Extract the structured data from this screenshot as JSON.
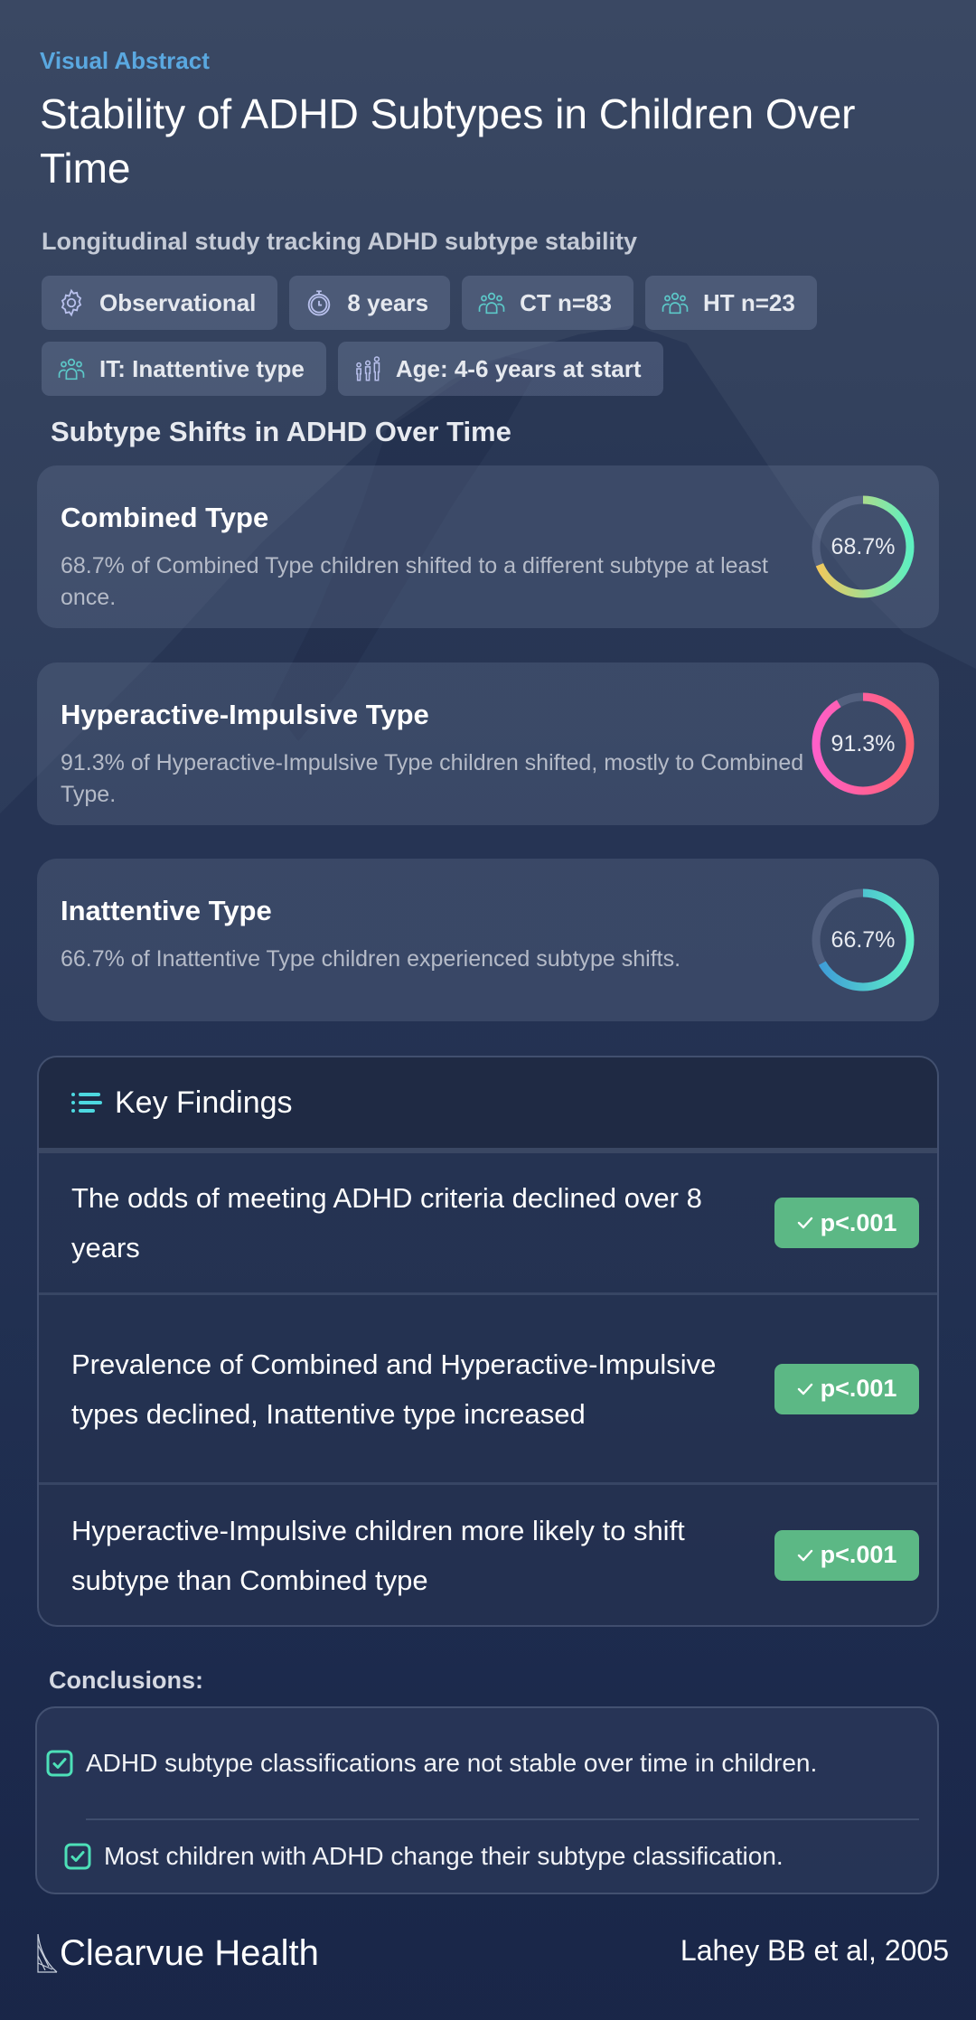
{
  "header": {
    "eyebrow": "Visual Abstract",
    "title": "Stability of ADHD Subtypes in Children Over Time",
    "subtitle": "Longitudinal study tracking ADHD subtype stability"
  },
  "tags": [
    {
      "icon": "gear-icon",
      "label": "Observational"
    },
    {
      "icon": "stopwatch-icon",
      "label": "8 years"
    },
    {
      "icon": "group-icon",
      "label": "CT n=83"
    },
    {
      "icon": "group-icon",
      "label": "HT n=23"
    },
    {
      "icon": "group-icon",
      "label": "IT: Inattentive type"
    },
    {
      "icon": "family-icon",
      "label": "Age: 4-6 years at start"
    }
  ],
  "subtype_section": {
    "title": "Subtype Shifts in ADHD Over Time",
    "cards": [
      {
        "name": "Combined Type",
        "description": "68.7% of Combined Type children shifted to a different subtype at least once.",
        "percent_label": "68.7%",
        "percent": 68.7,
        "gradient": [
          "#f5c85a",
          "#5ef0c0"
        ]
      },
      {
        "name": "Hyperactive-Impulsive Type",
        "description": "91.3% of Hyperactive-Impulsive Type children shifted, mostly to Combined Type.",
        "percent_label": "91.3%",
        "percent": 91.3,
        "gradient": [
          "#ff5fc8",
          "#ff6070"
        ]
      },
      {
        "name": "Inattentive Type",
        "description": "66.7% of Inattentive Type children experienced subtype shifts.",
        "percent_label": "66.7%",
        "percent": 66.7,
        "gradient": [
          "#3d98d8",
          "#5ef0c8"
        ]
      }
    ]
  },
  "key_findings": {
    "title": "Key Findings",
    "items": [
      {
        "text": "The odds of meeting ADHD criteria declined over 8 years",
        "badge": "p<.001"
      },
      {
        "text": "Prevalence of Combined and Hyperactive-Impulsive types declined, Inattentive type increased",
        "badge": "p<.001"
      },
      {
        "text": "Hyperactive-Impulsive children more likely to shift subtype than Combined type",
        "badge": "p<.001"
      }
    ]
  },
  "conclusions": {
    "label": "Conclusions:",
    "items": [
      "ADHD subtype classifications are not stable over time in children.",
      "Most children with ADHD change their subtype classification."
    ]
  },
  "footer": {
    "brand": "Clearvue Health",
    "citation": "Lahey BB et al, 2005"
  },
  "colors": {
    "accent": "#5aa8e0",
    "badge_green": "#5cb885",
    "check_teal": "#4de0b8",
    "list_icon_cyan": "#4dd8e0"
  }
}
